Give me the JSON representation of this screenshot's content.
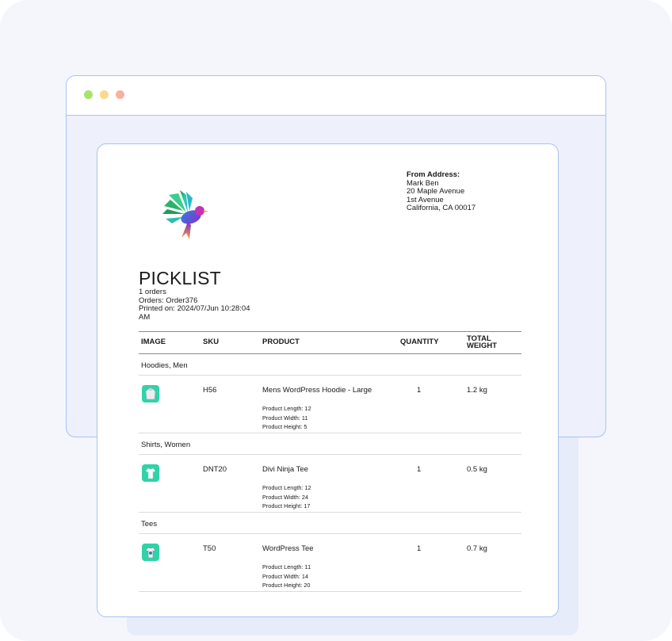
{
  "from_address": {
    "title": "From Address:",
    "lines": [
      "Mark Ben",
      "20 Maple Avenue",
      "1st Avenue",
      "California, CA 00017"
    ]
  },
  "picklist": {
    "title": "PICKLIST",
    "orders_count": "1 orders",
    "orders": "Orders: Order376",
    "printed_on": "Printed on: 2024/07/Jun 10:28:04 AM"
  },
  "table": {
    "headers": {
      "image": "IMAGE",
      "sku": "SKU",
      "product": "PRODUCT",
      "quantity": "QUANTITY",
      "total_weight": "TOTAL WEIGHT"
    },
    "groups": [
      {
        "label": "Hoodies, Men",
        "item": {
          "icon": "hoodie-icon",
          "sku": "H56",
          "product": "Mens WordPress Hoodie - Large",
          "quantity": "1",
          "weight": "1.2 kg",
          "length": "Product Length: 12",
          "width": "Product Width: 11",
          "height": "Product Height: 5"
        }
      },
      {
        "label": "Shirts, Women",
        "item": {
          "icon": "tee-icon",
          "sku": "DNT20",
          "product": "Divi Ninja Tee",
          "quantity": "1",
          "weight": "0.5 kg",
          "length": "Product Length: 12",
          "width": "Product Width: 24",
          "height": "Product Height: 17"
        }
      },
      {
        "label": "Tees",
        "item": {
          "icon": "tshirt-icon",
          "sku": "T50",
          "product": "WordPress Tee",
          "quantity": "1",
          "weight": "0.7 kg",
          "length": "Product Length: 11",
          "width": "Product Width: 14",
          "height": "Product Height: 20"
        }
      }
    ]
  },
  "colors": {
    "frame_border": "#a9c2f2",
    "thumb_bg": "#2fd3a7",
    "dot_green": "#a7e26a",
    "dot_yellow": "#fcd98a",
    "dot_red": "#f7b1a3"
  }
}
